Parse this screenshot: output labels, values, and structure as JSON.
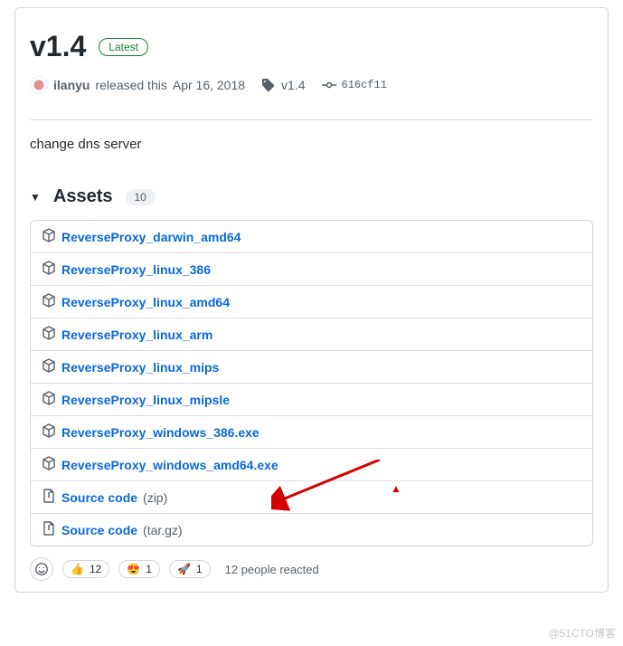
{
  "release": {
    "title": "v1.4",
    "latest_badge": "Latest",
    "author": "ilanyu",
    "released_text": "released this",
    "date": "Apr 16, 2018",
    "tag": "v1.4",
    "commit": "616cf11",
    "body": "change dns server"
  },
  "assets": {
    "header": "Assets",
    "count": "10",
    "items": [
      {
        "name": "ReverseProxy_darwin_amd64",
        "ext": "",
        "icon": "pkg"
      },
      {
        "name": "ReverseProxy_linux_386",
        "ext": "",
        "icon": "pkg"
      },
      {
        "name": "ReverseProxy_linux_amd64",
        "ext": "",
        "icon": "pkg"
      },
      {
        "name": "ReverseProxy_linux_arm",
        "ext": "",
        "icon": "pkg"
      },
      {
        "name": "ReverseProxy_linux_mips",
        "ext": "",
        "icon": "pkg"
      },
      {
        "name": "ReverseProxy_linux_mipsle",
        "ext": "",
        "icon": "pkg"
      },
      {
        "name": "ReverseProxy_windows_386.exe",
        "ext": "",
        "icon": "pkg"
      },
      {
        "name": "ReverseProxy_windows_amd64.exe",
        "ext": "",
        "icon": "pkg"
      },
      {
        "name": "Source code",
        "ext": "(zip)",
        "icon": "zip"
      },
      {
        "name": "Source code",
        "ext": "(tar.gz)",
        "icon": "zip"
      }
    ]
  },
  "reactions": {
    "thumbs_up": {
      "emoji": "👍",
      "count": "12"
    },
    "heart_eyes": {
      "emoji": "😍",
      "count": "1"
    },
    "rocket": {
      "emoji": "🚀",
      "count": "1"
    },
    "summary": "12 people reacted"
  },
  "watermark": "@51CTO博客"
}
